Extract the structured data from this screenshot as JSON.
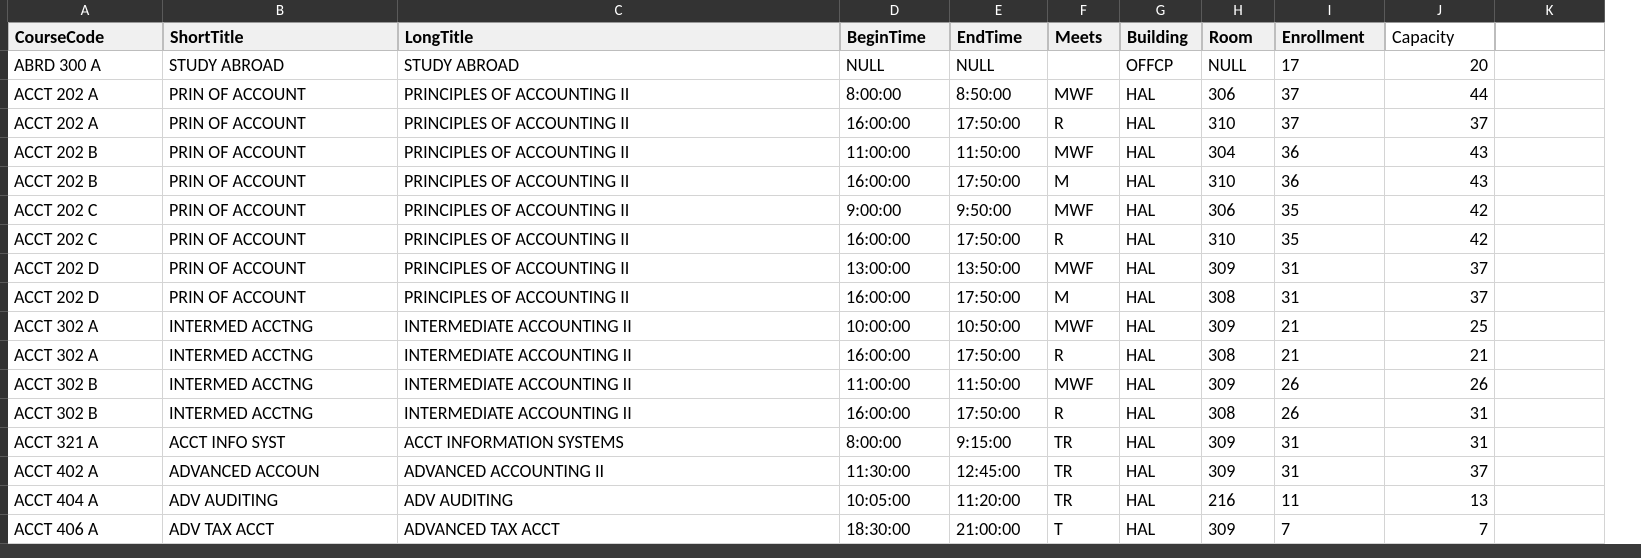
{
  "columns": [
    "A",
    "B",
    "C",
    "D",
    "E",
    "F",
    "G",
    "H",
    "I",
    "J",
    "K"
  ],
  "headers": {
    "A": "CourseCode",
    "B": "ShortTitle",
    "C": "LongTitle",
    "D": "BeginTime",
    "E": "EndTime",
    "F": "Meets",
    "G": "Building",
    "H": "Room",
    "I": "Enrollment",
    "J": "Capacity",
    "K": ""
  },
  "header_plain": [
    "J",
    "K"
  ],
  "rows": [
    {
      "A": "ABRD 300  A",
      "B": "STUDY ABROAD",
      "C": "STUDY ABROAD",
      "D": "NULL",
      "E": "NULL",
      "F": "",
      "G": "OFFCP",
      "H": "NULL",
      "I": "17",
      "J": "20",
      "K": ""
    },
    {
      "A": "ACCT 202  A",
      "B": "PRIN OF ACCOUNT",
      "C": "PRINCIPLES OF ACCOUNTING II",
      "D": "8:00:00",
      "E": "8:50:00",
      "F": "MWF",
      "G": "HAL",
      "H": "306",
      "I": "37",
      "J": "44",
      "K": ""
    },
    {
      "A": "ACCT 202  A",
      "B": "PRIN OF ACCOUNT",
      "C": "PRINCIPLES OF ACCOUNTING II",
      "D": "16:00:00",
      "E": "17:50:00",
      "F": "R",
      "G": "HAL",
      "H": "310",
      "I": "37",
      "J": "37",
      "K": ""
    },
    {
      "A": "ACCT 202  B",
      "B": "PRIN OF ACCOUNT",
      "C": "PRINCIPLES OF ACCOUNTING II",
      "D": "11:00:00",
      "E": "11:50:00",
      "F": "MWF",
      "G": "HAL",
      "H": "304",
      "I": "36",
      "J": "43",
      "K": ""
    },
    {
      "A": "ACCT 202  B",
      "B": "PRIN OF ACCOUNT",
      "C": "PRINCIPLES OF ACCOUNTING II",
      "D": "16:00:00",
      "E": "17:50:00",
      "F": "M",
      "G": "HAL",
      "H": "310",
      "I": "36",
      "J": "43",
      "K": ""
    },
    {
      "A": "ACCT 202  C",
      "B": "PRIN OF ACCOUNT",
      "C": "PRINCIPLES OF ACCOUNTING II",
      "D": "9:00:00",
      "E": "9:50:00",
      "F": "MWF",
      "G": "HAL",
      "H": "306",
      "I": "35",
      "J": "42",
      "K": ""
    },
    {
      "A": "ACCT 202  C",
      "B": "PRIN OF ACCOUNT",
      "C": "PRINCIPLES OF ACCOUNTING II",
      "D": "16:00:00",
      "E": "17:50:00",
      "F": "R",
      "G": "HAL",
      "H": "310",
      "I": "35",
      "J": "42",
      "K": ""
    },
    {
      "A": "ACCT 202  D",
      "B": "PRIN OF ACCOUNT",
      "C": "PRINCIPLES OF ACCOUNTING II",
      "D": "13:00:00",
      "E": "13:50:00",
      "F": "MWF",
      "G": "HAL",
      "H": "309",
      "I": "31",
      "J": "37",
      "K": ""
    },
    {
      "A": "ACCT 202  D",
      "B": "PRIN OF ACCOUNT",
      "C": "PRINCIPLES OF ACCOUNTING II",
      "D": "16:00:00",
      "E": "17:50:00",
      "F": "M",
      "G": "HAL",
      "H": "308",
      "I": "31",
      "J": "37",
      "K": ""
    },
    {
      "A": "ACCT 302  A",
      "B": "INTERMED ACCTNG",
      "C": "INTERMEDIATE ACCOUNTING II",
      "D": "10:00:00",
      "E": "10:50:00",
      "F": "MWF",
      "G": "HAL",
      "H": "309",
      "I": "21",
      "J": "25",
      "K": ""
    },
    {
      "A": "ACCT 302  A",
      "B": "INTERMED ACCTNG",
      "C": "INTERMEDIATE ACCOUNTING II",
      "D": "16:00:00",
      "E": "17:50:00",
      "F": "R",
      "G": "HAL",
      "H": "308",
      "I": "21",
      "J": "21",
      "K": ""
    },
    {
      "A": "ACCT 302  B",
      "B": "INTERMED ACCTNG",
      "C": "INTERMEDIATE ACCOUNTING II",
      "D": "11:00:00",
      "E": "11:50:00",
      "F": "MWF",
      "G": "HAL",
      "H": "309",
      "I": "26",
      "J": "26",
      "K": ""
    },
    {
      "A": "ACCT 302  B",
      "B": "INTERMED ACCTNG",
      "C": "INTERMEDIATE ACCOUNTING II",
      "D": "16:00:00",
      "E": "17:50:00",
      "F": "R",
      "G": "HAL",
      "H": "308",
      "I": "26",
      "J": "31",
      "K": ""
    },
    {
      "A": "ACCT 321  A",
      "B": "ACCT INFO SYST",
      "C": "ACCT INFORMATION SYSTEMS",
      "D": "8:00:00",
      "E": "9:15:00",
      "F": "TR",
      "G": "HAL",
      "H": "309",
      "I": "31",
      "J": "31",
      "K": ""
    },
    {
      "A": "ACCT 402  A",
      "B": "ADVANCED ACCOUN",
      "C": "ADVANCED ACCOUNTING II",
      "D": "11:30:00",
      "E": "12:45:00",
      "F": "TR",
      "G": "HAL",
      "H": "309",
      "I": "31",
      "J": "37",
      "K": ""
    },
    {
      "A": "ACCT 404  A",
      "B": "ADV AUDITING",
      "C": "ADV AUDITING",
      "D": "10:05:00",
      "E": "11:20:00",
      "F": "TR",
      "G": "HAL",
      "H": "216",
      "I": "11",
      "J": "13",
      "K": ""
    },
    {
      "A": "ACCT 406  A",
      "B": "ADV TAX ACCT",
      "C": "ADVANCED TAX ACCT",
      "D": "18:30:00",
      "E": "21:00:00",
      "F": "T",
      "G": "HAL",
      "H": "309",
      "I": "7",
      "J": "7",
      "K": ""
    }
  ],
  "numeric_columns": [
    "J"
  ]
}
